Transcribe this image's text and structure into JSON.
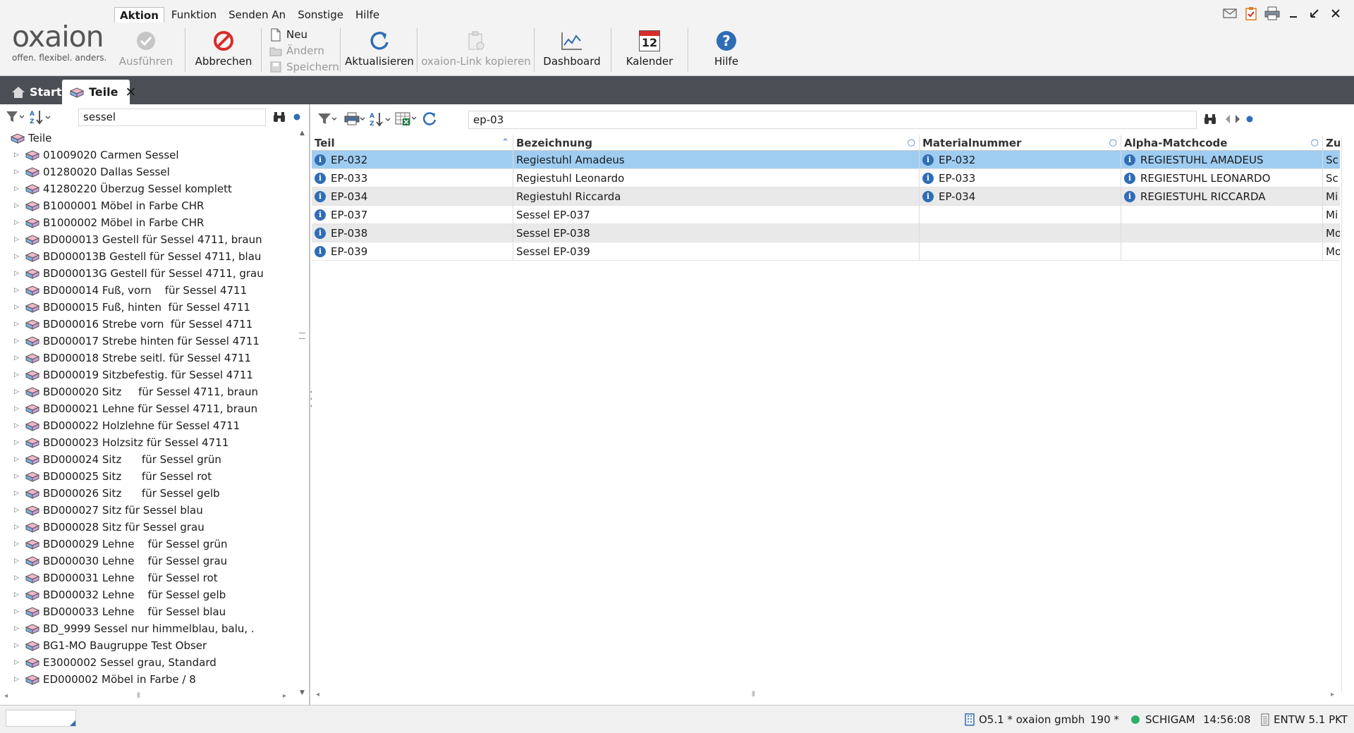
{
  "window": {
    "menu": [
      "Aktion",
      "Funktion",
      "Senden An",
      "Sonstige",
      "Hilfe"
    ],
    "active_menu": "Aktion",
    "controls": [
      "mail-icon",
      "tasks-icon",
      "print-icon",
      "minimize-icon",
      "restore-icon",
      "close-icon"
    ]
  },
  "logo": {
    "brand": "oxaion",
    "tagline": "offen. flexibel. anders."
  },
  "toolbar": {
    "ausfuehren": "Ausführen",
    "abbrechen": "Abbrechen",
    "neu": "Neu",
    "aendern": "Ändern",
    "speichern": "Speichern",
    "aktualisieren": "Aktualisieren",
    "link_kopieren": "oxaion-Link kopieren",
    "dashboard": "Dashboard",
    "kalender": "Kalender",
    "kalender_day": "12",
    "hilfe": "Hilfe"
  },
  "tabs": {
    "start": "Start",
    "teile": "Teile"
  },
  "left": {
    "search_value": "sessel",
    "root": "Teile",
    "items": [
      "01009020 Carmen Sessel",
      "01280020 Dallas Sessel",
      "41280220 Überzug Sessel komplett",
      "B1000001 Möbel in Farbe CHR",
      "B1000002 Möbel in Farbe CHR",
      "BD000013 Gestell für Sessel 4711, braun",
      "BD000013B Gestell für Sessel 4711, blau",
      "BD000013G Gestell für Sessel 4711, grau",
      "BD000014 Fuß, vorn    für Sessel 4711",
      "BD000015 Fuß, hinten  für Sessel 4711",
      "BD000016 Strebe vorn  für Sessel 4711",
      "BD000017 Strebe hinten für Sessel 4711",
      "BD000018 Strebe seitl. für Sessel 4711",
      "BD000019 Sitzbefestig. für Sessel 4711",
      "BD000020 Sitz     für Sessel 4711, braun",
      "BD000021 Lehne für Sessel 4711, braun",
      "BD000022 Holzlehne für Sessel 4711",
      "BD000023 Holzsitz für Sessel 4711",
      "BD000024 Sitz      für Sessel grün",
      "BD000025 Sitz      für Sessel rot",
      "BD000026 Sitz      für Sessel gelb",
      "BD000027 Sitz für Sessel blau",
      "BD000028 Sitz für Sessel grau",
      "BD000029 Lehne    für Sessel grün",
      "BD000030 Lehne    für Sessel grau",
      "BD000031 Lehne    für Sessel rot",
      "BD000032 Lehne    für Sessel gelb",
      "BD000033 Lehne    für Sessel blau",
      "BD_9999 Sessel nur himmelblau, balu, .",
      "BG1-MO Baugruppe Test Obser",
      "E3000002 Sessel grau, Standard",
      "ED000002 Möbel in Farbe / 8"
    ]
  },
  "grid": {
    "search_value": "ep-03",
    "columns": [
      "Teil",
      "Bezeichnung",
      "Materialnummer",
      "Alpha-Matchcode",
      "Zu"
    ],
    "rows": [
      {
        "teil": "EP-032",
        "bezeichnung": "Regiestuhl Amadeus",
        "material": "EP-032",
        "matchcode": "REGIESTUHL AMADEUS",
        "zu": "Sc",
        "selected": true
      },
      {
        "teil": "EP-033",
        "bezeichnung": "Regiestuhl Leonardo",
        "material": "EP-033",
        "matchcode": "REGIESTUHL LEONARDO",
        "zu": "Sc"
      },
      {
        "teil": "EP-034",
        "bezeichnung": "Regiestuhl Riccarda",
        "material": "EP-034",
        "matchcode": "REGIESTUHL RICCARDA",
        "zu": "Mi"
      },
      {
        "teil": "EP-037",
        "bezeichnung": "Sessel EP-037",
        "material": "",
        "matchcode": "",
        "zu": "Mi"
      },
      {
        "teil": "EP-038",
        "bezeichnung": "Sessel EP-038",
        "material": "",
        "matchcode": "",
        "zu": "Mo"
      },
      {
        "teil": "EP-039",
        "bezeichnung": "Sessel EP-039",
        "material": "",
        "matchcode": "",
        "zu": "Mo"
      }
    ]
  },
  "status": {
    "company": "O5.1 * oxaion gmbh",
    "number": "190 *",
    "user": "SCHIGAM",
    "time": "14:56:08",
    "env": "ENTW 5.1 PKT"
  },
  "colors": {
    "selection": "#9fcdf2",
    "accent": "#2f6db6",
    "cancel": "#d92b2b",
    "tabbar": "#4b4f55"
  }
}
